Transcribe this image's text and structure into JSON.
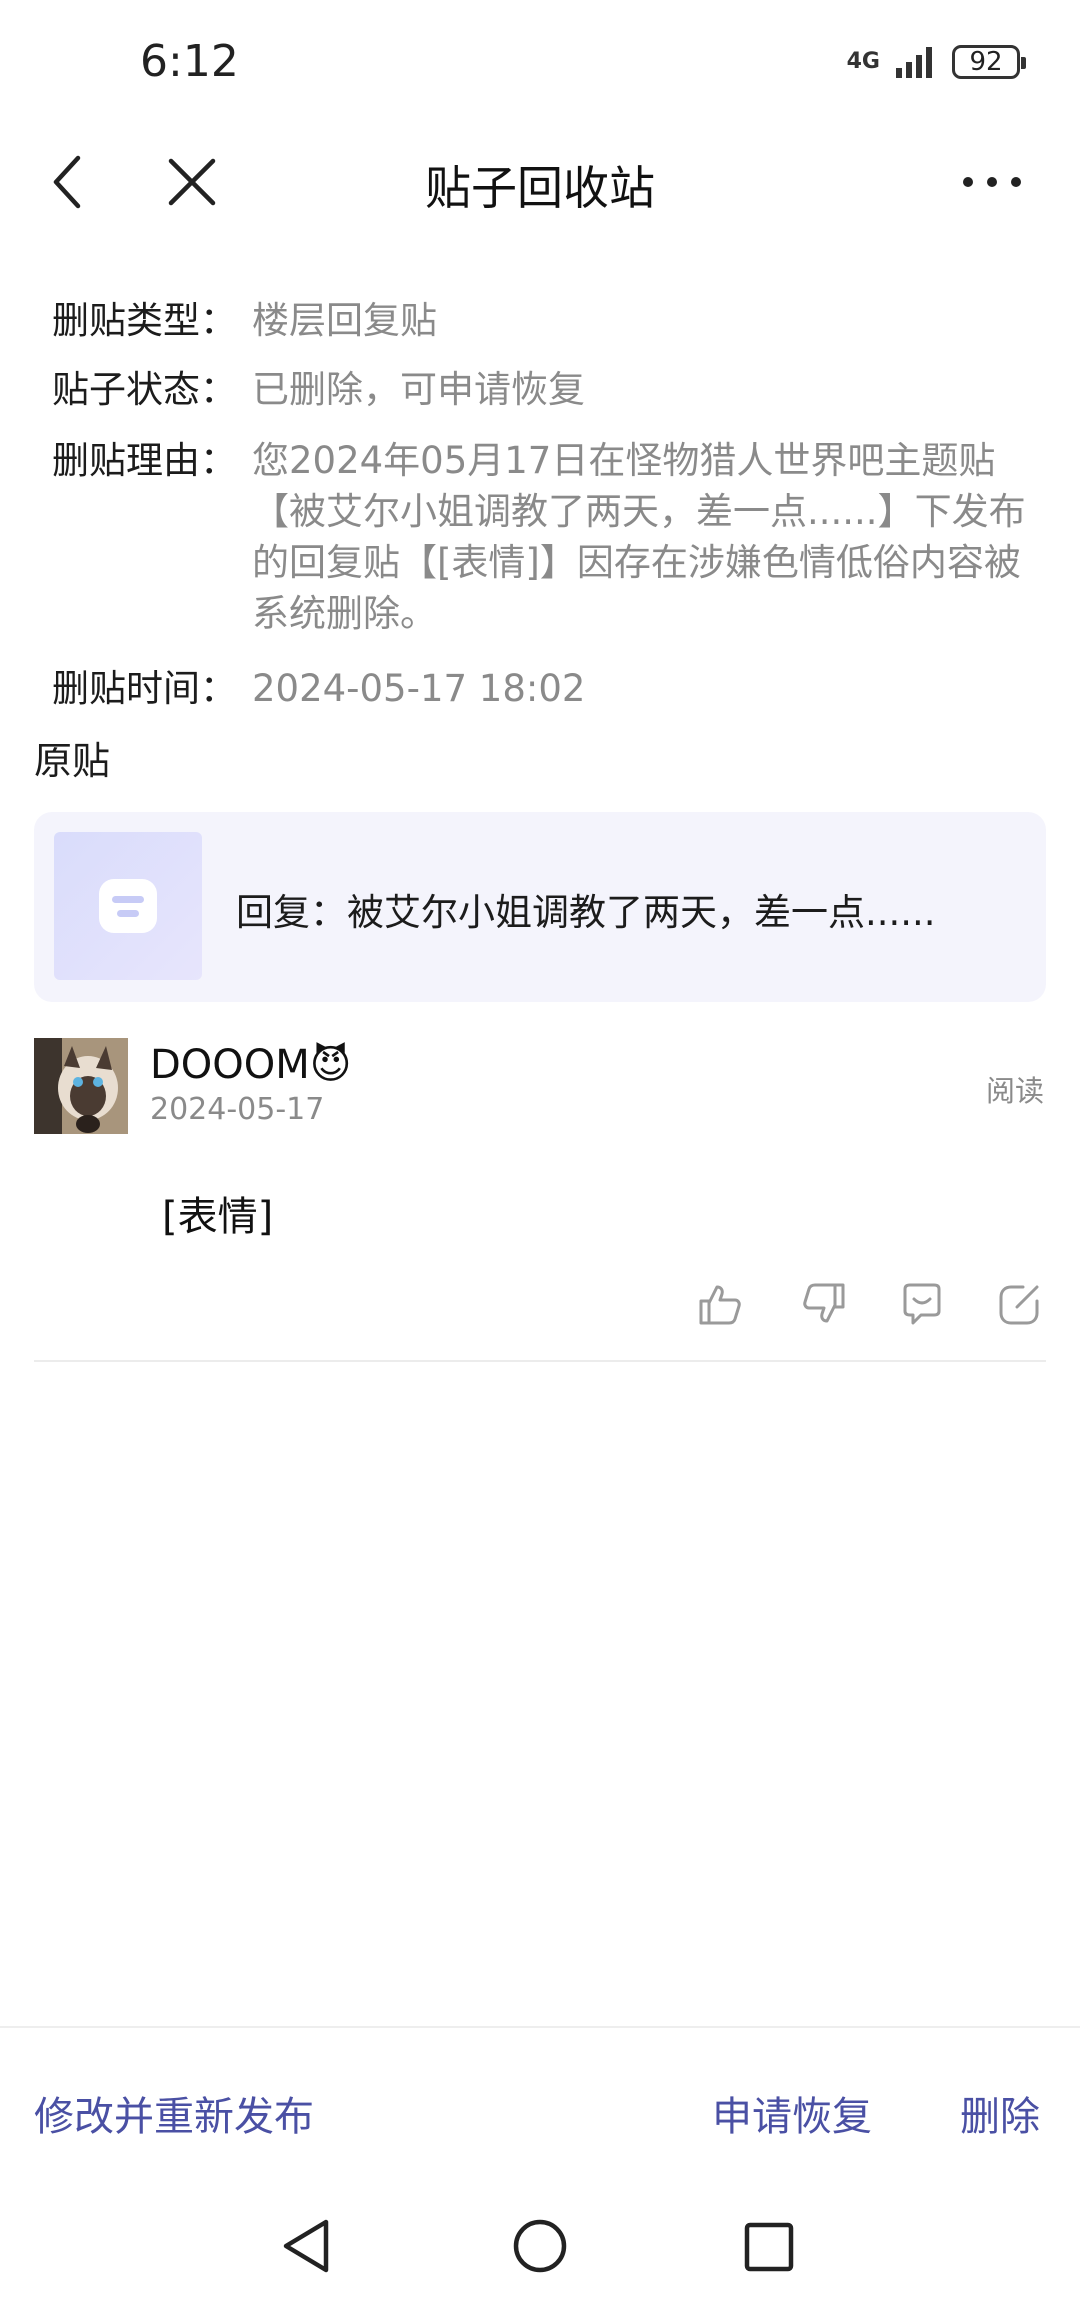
{
  "status_bar": {
    "time": "6:12",
    "network": "4G",
    "battery": "92"
  },
  "nav": {
    "title": "贴子回收站",
    "back_icon": "chevron-left-icon",
    "close_icon": "close-icon",
    "more_icon": "more-icon"
  },
  "info": [
    {
      "label": "删贴类型：",
      "value": "楼层回复贴"
    },
    {
      "label": "贴子状态：",
      "value": "已删除，可申请恢复"
    },
    {
      "label": "删贴理由：",
      "value": "您2024年05月17日在怪物猎人世界吧主题贴【被艾尔小姐调教了两天，差一点......】下发布的回复贴【[表情]】因存在涉嫌色情低俗内容被系统删除。"
    },
    {
      "label": "删贴时间：",
      "value": "2024-05-17 18:02"
    }
  ],
  "original_section": {
    "title": "原贴",
    "card_text": "回复：被艾尔小姐调教了两天，差一点......"
  },
  "post": {
    "username": "DOOOM😈",
    "date": "2024-05-17",
    "read_label": "阅读",
    "content": "[表情]",
    "action_icons": [
      "thumbs-up-icon",
      "thumbs-down-icon",
      "comment-icon",
      "edit-icon"
    ]
  },
  "bottom_bar": {
    "edit_republish": "修改并重新发布",
    "request_restore": "申请恢复",
    "delete": "删除"
  },
  "colors": {
    "accent": "#4a50a4",
    "muted": "#8a8a8a",
    "card_bg": "#f4f4fc"
  }
}
